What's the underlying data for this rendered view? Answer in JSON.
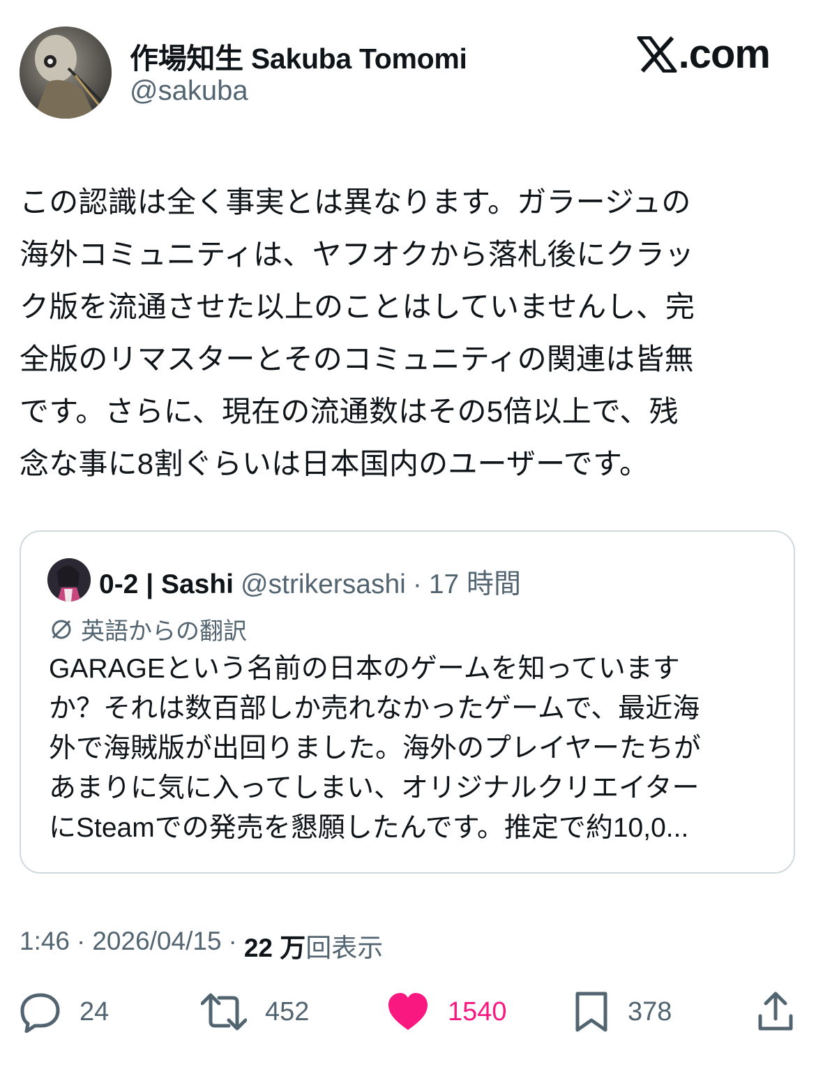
{
  "author": {
    "display_name": "作場知生 Sakuba Tomomi",
    "handle": "@sakuba",
    "avatar": "avatar-image"
  },
  "brand": {
    "logo": "x-logo-icon",
    "text": ".com"
  },
  "tweet": {
    "text_lines": [
      "この認識は全く事実とは異なります。ガラージュの",
      "海外コミュニティは、ヤフオクから落札後にクラッ",
      "ク版を流通させた以上のことはしていませんし、完",
      "全版のリマスターとそのコミュニティの関連は皆無",
      "です。さらに、現在の流通数はその5倍以上で、残",
      "念な事に8割ぐらいは日本国内のユーザーです。"
    ]
  },
  "quote": {
    "name": "0-2 | Sashi",
    "handle": "@strikersashi",
    "separator": "·",
    "time": "17 時間",
    "translation_label": "英語からの翻訳",
    "text_lines": [
      "GARAGEという名前の日本のゲームを知っています",
      "か？それは数百部しか売れなかったゲームで、最近海",
      "外で海賊版が出回りました。海外のプレイヤーたちが",
      "あまりに気に入ってしまい、オリジナルクリエイター",
      "にSteamでの発売を懇願したんです。推定で約10,0..."
    ]
  },
  "meta": {
    "time": "1:46",
    "sep1": "·",
    "date": "2026/04/15",
    "sep2": "·",
    "views_count": "22 万",
    "views_label": "回表示"
  },
  "actions": {
    "replies": "24",
    "reposts": "452",
    "likes": "1540",
    "bookmarks": "378",
    "like_color": "#f91880",
    "icon_color": "#536471"
  }
}
